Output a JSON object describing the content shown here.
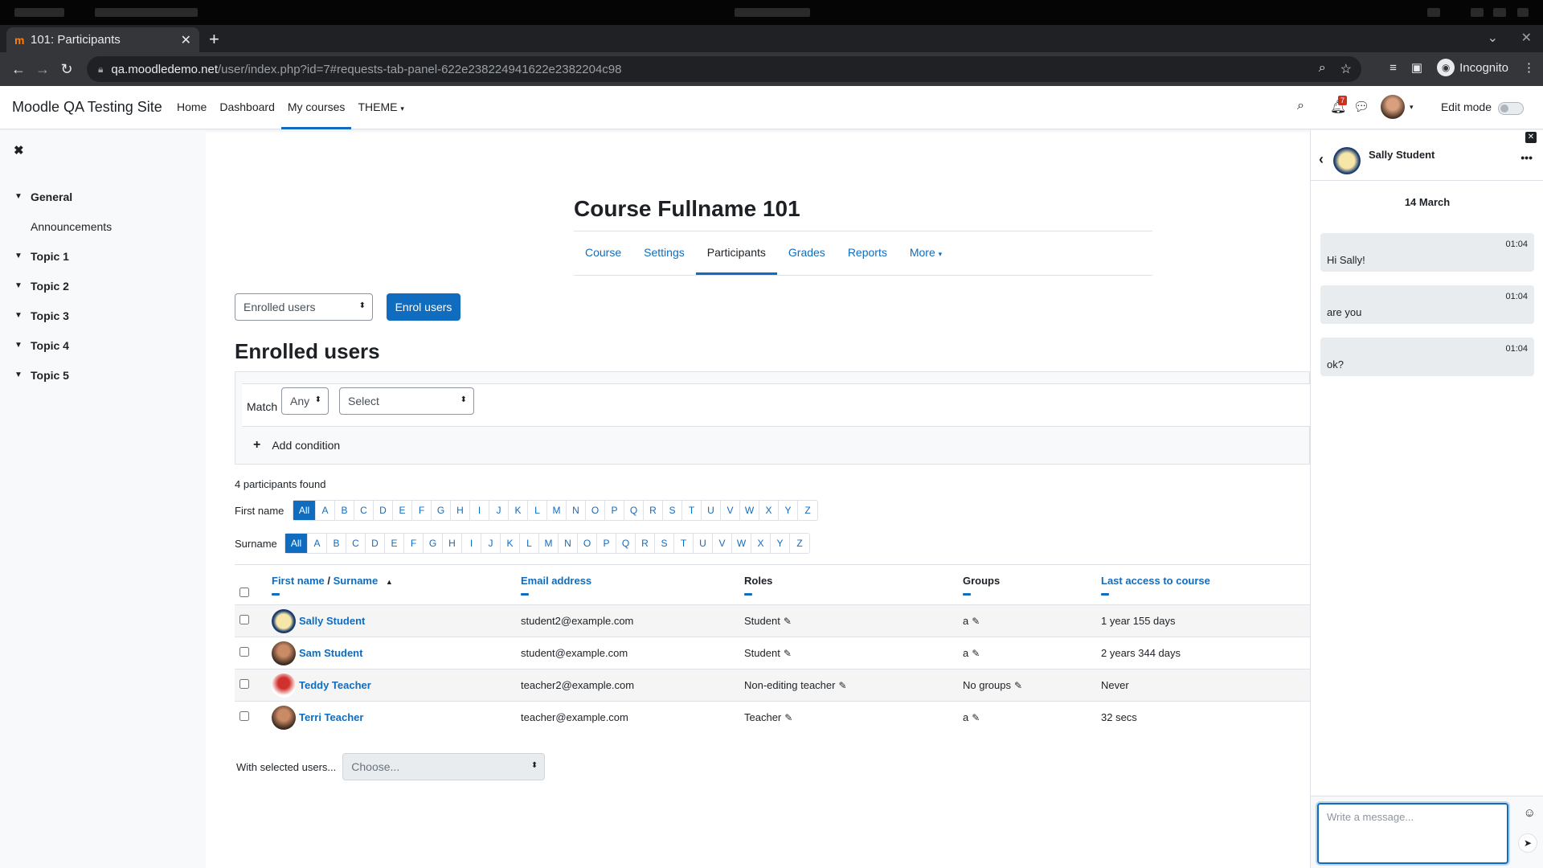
{
  "browser": {
    "tab_title": "101: Participants",
    "favicon": "m",
    "url_host": "qa.moodledemo.net",
    "url_path": "/user/index.php?id=7#requests-tab-panel-622e238224941622e2382204c98",
    "profile_label": "Incognito"
  },
  "site": {
    "brand": "Moodle QA Testing Site",
    "nav": [
      "Home",
      "Dashboard",
      "My courses",
      "THEME"
    ],
    "notification_count": "7",
    "edit_mode_label": "Edit mode"
  },
  "drawer": {
    "items": [
      {
        "label": "General",
        "sub": [
          "Announcements"
        ]
      },
      {
        "label": "Topic 1",
        "sub": []
      },
      {
        "label": "Topic 2",
        "sub": []
      },
      {
        "label": "Topic 3",
        "sub": []
      },
      {
        "label": "Topic 4",
        "sub": []
      },
      {
        "label": "Topic 5",
        "sub": []
      }
    ]
  },
  "course": {
    "title": "Course Fullname 101",
    "tabs": [
      "Course",
      "Settings",
      "Participants",
      "Grades",
      "Reports",
      "More"
    ]
  },
  "participants": {
    "view_select": "Enrolled users",
    "enrol_button": "Enrol users",
    "heading": "Enrolled users",
    "filter": {
      "match_label": "Match",
      "match_value": "Any",
      "type_value": "Select",
      "add_condition": "Add condition"
    },
    "found_text": "4 participants found",
    "firstname_label": "First name",
    "surname_label": "Surname",
    "letters": [
      "All",
      "A",
      "B",
      "C",
      "D",
      "E",
      "F",
      "G",
      "H",
      "I",
      "J",
      "K",
      "L",
      "M",
      "N",
      "O",
      "P",
      "Q",
      "R",
      "S",
      "T",
      "U",
      "V",
      "W",
      "X",
      "Y",
      "Z"
    ],
    "columns": {
      "first_name": "First name",
      "separator": " / ",
      "surname": "Surname",
      "email": "Email address",
      "roles": "Roles",
      "groups": "Groups",
      "last_access": "Last access to course"
    },
    "rows": [
      {
        "name": "Sally Student",
        "email": "student2@example.com",
        "role": "Student",
        "group": "a",
        "last_access": "1 year 155 days",
        "avatar": "smiley"
      },
      {
        "name": "Sam Student",
        "email": "student@example.com",
        "role": "Student",
        "group": "a",
        "last_access": "2 years 344 days",
        "avatar": "photo"
      },
      {
        "name": "Teddy Teacher",
        "email": "teacher2@example.com",
        "role": "Non-editing teacher",
        "group": "No groups",
        "last_access": "Never",
        "avatar": "teddy"
      },
      {
        "name": "Terri Teacher",
        "email": "teacher@example.com",
        "role": "Teacher",
        "group": "a",
        "last_access": "32 secs",
        "avatar": "photo"
      }
    ],
    "bulk_label": "With selected users...",
    "bulk_select": "Choose..."
  },
  "messages": {
    "contact": "Sally Student",
    "date": "14 March",
    "items": [
      {
        "time": "01:04",
        "text": "Hi Sally!"
      },
      {
        "time": "01:04",
        "text": "are you"
      },
      {
        "time": "01:04",
        "text": "ok?"
      }
    ],
    "input_placeholder": "Write a message..."
  },
  "colors": {
    "brand_blue": "#0f6cbf",
    "chrome_dark": "#202124",
    "notification_red": "#ca3120"
  }
}
